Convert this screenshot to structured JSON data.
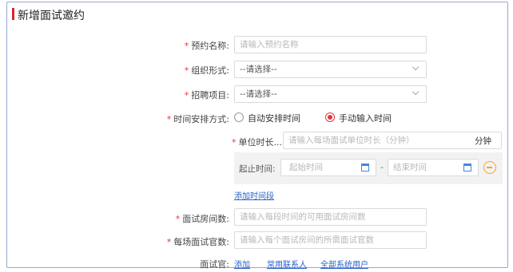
{
  "header": {
    "title": "新增面试邀约"
  },
  "form": {
    "name": {
      "label": "预约名称:",
      "placeholder": "请输入预约名称"
    },
    "org": {
      "label": "组织形式:",
      "value": "--请选择--"
    },
    "project": {
      "label": "招聘项目:",
      "value": "--请选择--"
    },
    "schedule": {
      "label": "时间安排方式:",
      "auto_label": "自动安排时间",
      "manual_label": "手动输入时间",
      "selected": "manual"
    },
    "duration": {
      "label": "单位时长...",
      "placeholder": "请输入每场面试单位时长（分钟）",
      "unit": "分钟"
    },
    "period": {
      "label": "起止时间:",
      "start_placeholder": "起始时间",
      "separator": "-",
      "end_placeholder": "结束时间"
    },
    "add_period": "添加时间段",
    "rooms": {
      "label": "面试房间数:",
      "placeholder": "请输入每段时间的可用面试房间数"
    },
    "interviewers_count": {
      "label": "每场面试官数:",
      "placeholder": "请输入每个面试房间的所需面试官数"
    },
    "interviewer": {
      "label": "面试官:",
      "links": [
        "添加",
        "常用联系人",
        "全部系统用户"
      ]
    },
    "required_mark": "*"
  },
  "colors": {
    "accent": "#d9252c",
    "required": "#e2363b",
    "link": "#2a62c8",
    "minus": "#ff9d2e"
  }
}
